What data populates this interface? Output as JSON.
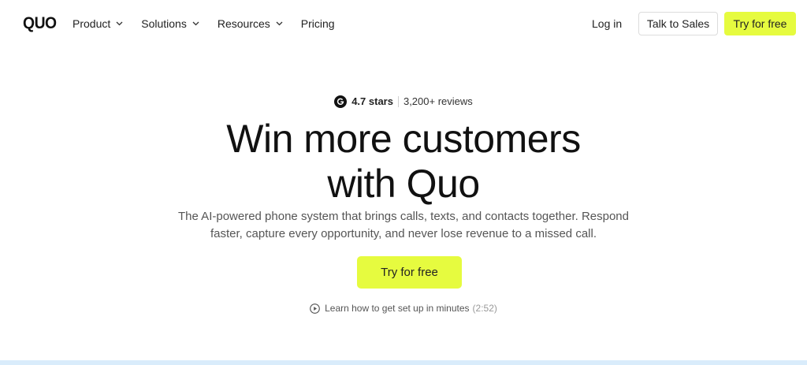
{
  "nav": {
    "logo": "QUO",
    "links": [
      {
        "label": "Product",
        "dropdown": true
      },
      {
        "label": "Solutions",
        "dropdown": true
      },
      {
        "label": "Resources",
        "dropdown": true
      },
      {
        "label": "Pricing",
        "dropdown": false
      }
    ],
    "login": "Log in",
    "talk_to_sales": "Talk to Sales",
    "try_free": "Try for free"
  },
  "hero": {
    "rating_icon": "g2-icon",
    "stars": "4.7 stars",
    "reviews": "3,200+ reviews",
    "headline_line1": "Win more customers",
    "headline_line2": "with Quo",
    "subtitle": "The AI-powered phone system that brings calls, texts, and contacts together. Respond faster, capture every opportunity, and never lose revenue to a missed call.",
    "cta": "Try for free",
    "video_icon": "play-circle-icon",
    "video_text": "Learn how to get set up in minutes",
    "video_duration": "(2:52)"
  },
  "colors": {
    "accent": "#e6fb3f",
    "text": "#111111",
    "muted": "#555555",
    "strip": "#d9ecfb"
  }
}
